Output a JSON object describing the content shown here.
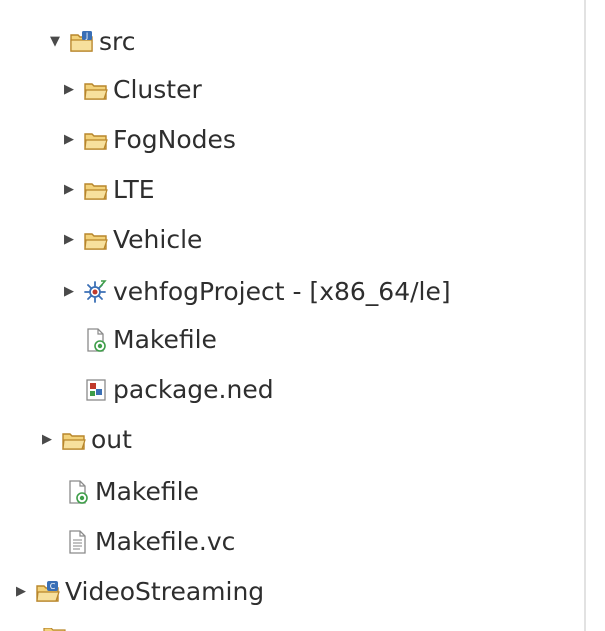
{
  "tree": {
    "items": [
      {
        "label": "src",
        "toggle": "▼",
        "icon": "source-folder-icon"
      },
      {
        "label": "Cluster",
        "toggle": "▶",
        "icon": "folder-icon"
      },
      {
        "label": "FogNodes",
        "toggle": "▶",
        "icon": "folder-icon"
      },
      {
        "label": "LTE",
        "toggle": "▶",
        "icon": "folder-icon"
      },
      {
        "label": "Vehicle",
        "toggle": "▶",
        "icon": "folder-icon"
      },
      {
        "label": "vehfogProject - [x86_64/le]",
        "toggle": "▶",
        "icon": "binary-icon"
      },
      {
        "label": "Makefile",
        "toggle": "",
        "icon": "makefile-icon"
      },
      {
        "label": "package.ned",
        "toggle": "",
        "icon": "ned-file-icon"
      },
      {
        "label": "out",
        "toggle": "▶",
        "icon": "folder-icon"
      },
      {
        "label": "Makefile",
        "toggle": "",
        "icon": "makefile-icon"
      },
      {
        "label": "Makefile.vc",
        "toggle": "",
        "icon": "text-file-icon"
      },
      {
        "label": "VideoStreaming",
        "toggle": "▶",
        "icon": "cpp-project-icon"
      }
    ]
  },
  "colors": {
    "folder_fill": "#f3d27a",
    "folder_stroke": "#b8862b",
    "text": "#2e2e2e",
    "accent_blue": "#3a6fb5",
    "accent_green": "#3f9e4a",
    "accent_red": "#c0392b"
  }
}
